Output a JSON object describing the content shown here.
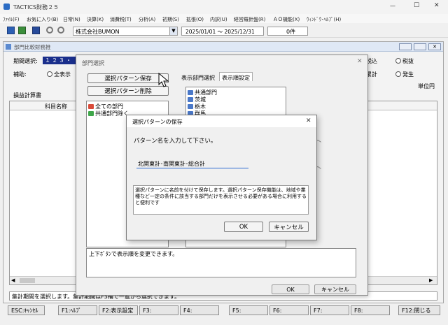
{
  "app": {
    "title": "TACTICS財務２５",
    "window_controls": {
      "minimize": "—",
      "maximize": "☐",
      "close": "✕"
    },
    "menu": [
      "ﾌｧｲﾙ(F)",
      "お気に入り(B)",
      "日常(N)",
      "決算(K)",
      "消費税(T)",
      "分析(A)",
      "初期(S)",
      "拡張(O)",
      "内訳(U)",
      "経営羅針盤(R)",
      "ＡＯ機能(X)",
      "ｳｨﾝﾄﾞｳ･ﾍﾙﾌﾟ(H)"
    ],
    "toolbar": {
      "company": "株式会社BUMON",
      "date_range": "2025/01/01 ～ 2025/12/31",
      "count": "0件"
    }
  },
  "bg_window": {
    "title": "部門比較財務推",
    "period_label": "期間選択:",
    "period_value": "１２３・",
    "aux_label": "補助:",
    "radio_all": "全表示",
    "radio_tax_incl": "税込",
    "radio_tax_excl": "税抜",
    "cumulative": "累計",
    "radio_occur": "発生",
    "unit_label": "単位円",
    "section_label": "損益計算書",
    "column_header": "科目名称",
    "status_text": "集計期間を選択します。集計期間はF5補で一覧から選択できます。",
    "fkeys": [
      "ESC:ｷｬﾝｾﾙ",
      "F1:ﾍﾙﾌﾟ",
      "F2:表示設定",
      "F3:",
      "F4:",
      "F5:",
      "F6:",
      "F7:",
      "F8:",
      "F12:閉じる"
    ]
  },
  "dept_dialog": {
    "title": "部門選択",
    "btn_save_pattern": "選択パターン保存",
    "btn_delete_pattern": "選択パターン削除",
    "left_tree": [
      "全ての部門",
      "共通部門除く"
    ],
    "tab_selected": "表示部門選択",
    "tab_order": "表示順設定",
    "right_tree": [
      "共通部門",
      "茨城",
      "栃木",
      "群馬"
    ],
    "info_text": "上下ﾎﾞﾀﾝで表示順を変更できます。",
    "ok": "OK",
    "cancel": "キャンセル"
  },
  "save_dialog": {
    "title": "選択パターンの保存",
    "prompt": "パターン名を入力して下さい。",
    "input_value": "北関東計･南関東計･総合計",
    "help_text": "選択パターンに名前を付けて保存します。選択パターン保存機能は、地域や業種など一定の条件に該当する部門だけを表示させる必要がある場合に利用すると便利です",
    "ok": "OK",
    "cancel": "キャンセル"
  }
}
